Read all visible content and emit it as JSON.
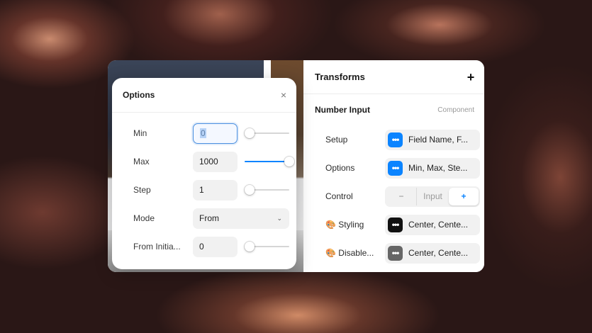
{
  "transforms_panel": {
    "title": "Transforms",
    "add_icon": "plus-icon",
    "section_title": "Number Input",
    "section_tag": "Component",
    "props": [
      {
        "label": "Setup",
        "value": "Field Name, F...",
        "chip_color": "#0b84ff",
        "chip_glyph": "•••"
      },
      {
        "label": "Options",
        "value": "Min, Max, Ste...",
        "chip_color": "#0b84ff",
        "chip_glyph": "•••"
      },
      {
        "label": "🎨 Styling",
        "value": "Center, Cente...",
        "chip_color": "#111111",
        "chip_glyph": "•••"
      },
      {
        "label": "🎨 Disable...",
        "value": "Center, Cente...",
        "chip_color": "#666666",
        "chip_glyph": "•••"
      }
    ],
    "control": {
      "label": "Control",
      "minus": "−",
      "middle": "Input",
      "plus": "+"
    }
  },
  "options_popup": {
    "title": "Options",
    "close": "×",
    "rows": [
      {
        "label": "Min",
        "value": "0",
        "slider_fraction": 0.0
      },
      {
        "label": "Max",
        "value": "1000",
        "slider_fraction": 1.0
      },
      {
        "label": "Step",
        "value": "1",
        "slider_fraction": 0.0
      },
      {
        "label": "From Initia...",
        "value": "0",
        "slider_fraction": 0.0
      }
    ],
    "mode": {
      "label": "Mode",
      "value": "From"
    }
  },
  "colors": {
    "accent": "#0b84ff"
  }
}
